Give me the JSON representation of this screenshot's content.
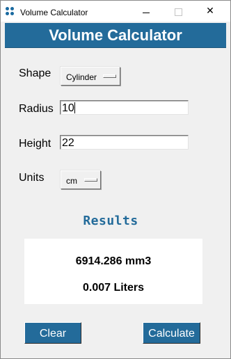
{
  "window": {
    "title": "Volume Calculator",
    "minimize_label": "—",
    "maximize_label": "☐",
    "close_label": "✕"
  },
  "header": {
    "title": "Volume Calculator"
  },
  "form": {
    "shape_label": "Shape",
    "shape_value": "Cylinder",
    "radius_label": "Radius",
    "radius_value": "10",
    "height_label": "Height",
    "height_value": "22",
    "units_label": "Units",
    "units_value": "cm"
  },
  "results": {
    "title": "Results",
    "volume_mm3": "6914.286 mm3",
    "volume_liters": "0.007 Liters"
  },
  "buttons": {
    "clear": "Clear",
    "calculate": "Calculate"
  },
  "colors": {
    "accent": "#236b9a",
    "window_bg": "#f0f0f0"
  },
  "icons": {
    "app": "app-dots-icon"
  }
}
